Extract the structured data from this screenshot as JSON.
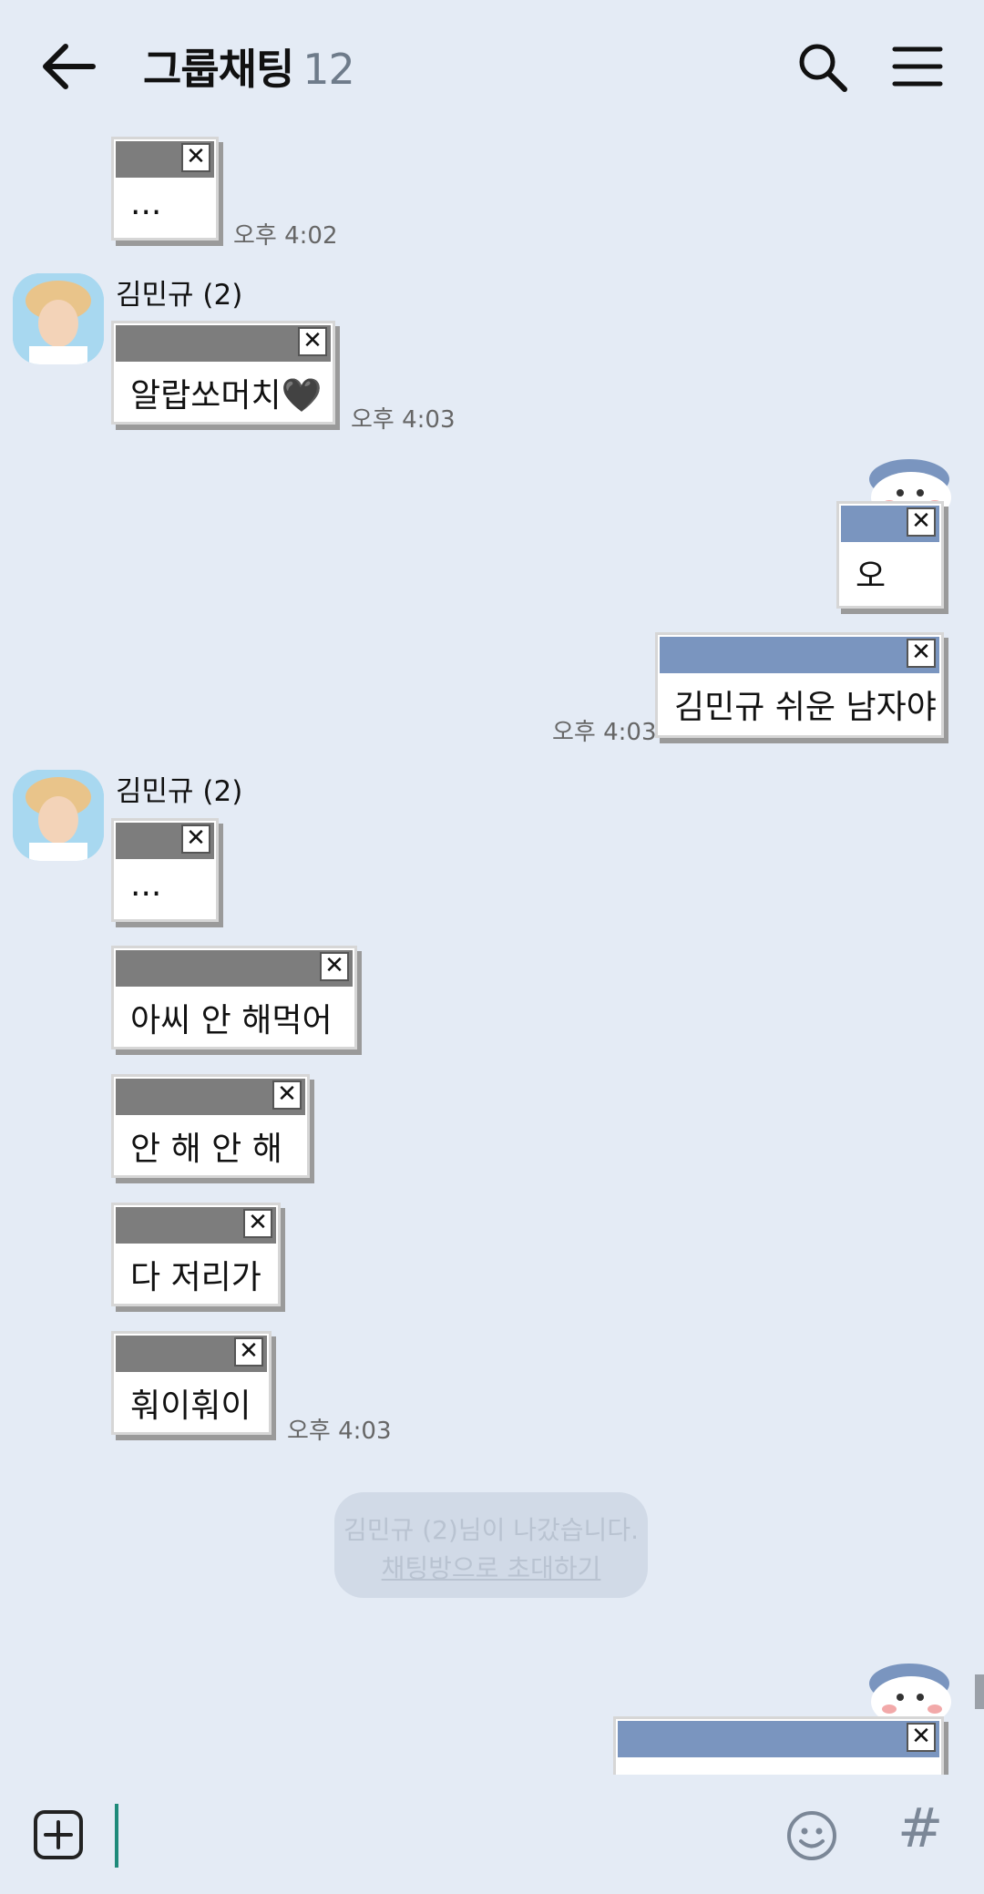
{
  "header": {
    "title": "그룹채팅",
    "member_count": "12"
  },
  "messages": {
    "m1": {
      "text": "...",
      "time": "오후 4:02"
    },
    "m2": {
      "sender": "김민규 (2)",
      "text": "알랍쏘머치🖤",
      "time": "오후 4:03"
    },
    "m3": {
      "text": "오"
    },
    "m4": {
      "text": "김민규 쉬운 남자야",
      "time": "오후 4:03"
    },
    "m5": {
      "sender": "김민규 (2)",
      "text": "..."
    },
    "m6": {
      "text": "아씨 안 해먹어"
    },
    "m7": {
      "text": "안 해 안 해"
    },
    "m8": {
      "text": "다 저리가"
    },
    "m9": {
      "text": "훠이훠이",
      "time": "오후 4:03"
    }
  },
  "system_notice": {
    "text": "김민규 (2)님이 나갔습니다.",
    "link": "채팅방으로 초대하기"
  },
  "close_glyph": "✕",
  "input": {
    "hash_label": "#"
  },
  "icons": {
    "back": "back-arrow-icon",
    "search": "search-icon",
    "menu": "menu-icon",
    "add": "add-icon",
    "emoji": "emoji-icon"
  },
  "colors": {
    "background": "#e4ebf5",
    "my_bubble_bar": "#7a95bf",
    "their_bubble_bar": "#7d7d7d",
    "caret": "#1e8a7a"
  }
}
